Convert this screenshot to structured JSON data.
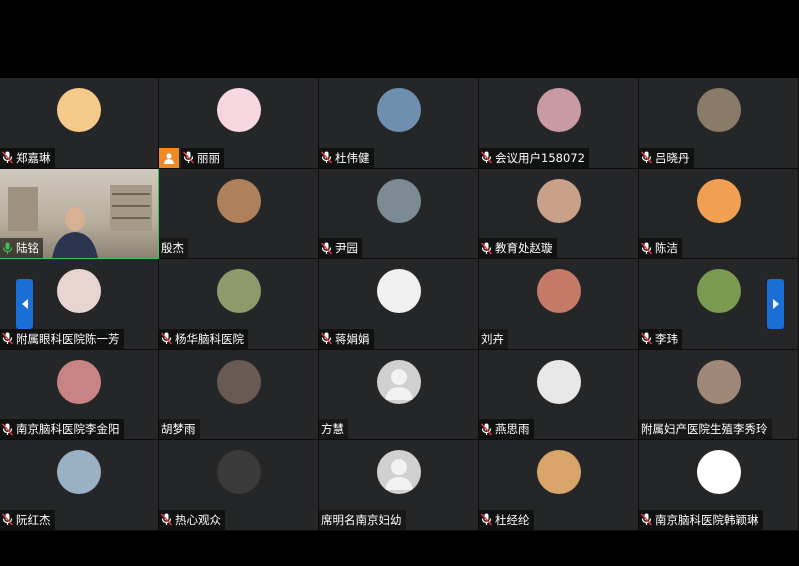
{
  "participants": [
    {
      "name": "郑嘉琳",
      "muted": true,
      "avatar": "cartoon-bear-avatar",
      "color": "#f4c98a"
    },
    {
      "name": "丽丽",
      "muted": true,
      "host": true,
      "avatar": "pink-calligraphy-avatar",
      "color": "#f6d6df"
    },
    {
      "name": "杜伟健",
      "muted": true,
      "avatar": "lake-landscape-avatar",
      "color": "#6f8fae"
    },
    {
      "name": "会议用户158072",
      "muted": true,
      "avatar": "bunny-avatar",
      "color": "#c89aa4"
    },
    {
      "name": "吕晓丹",
      "muted": true,
      "avatar": "room-photo-avatar",
      "color": "#8a7a68"
    },
    {
      "name": "陆铭",
      "muted": false,
      "video": true,
      "avatar": "live-video",
      "color": "#b7ae9d"
    },
    {
      "name": "殷杰",
      "muted": null,
      "avatar": "flower-photo-avatar",
      "color": "#b0805a"
    },
    {
      "name": "尹园",
      "muted": true,
      "avatar": "landscape-person-avatar",
      "color": "#7b8a93"
    },
    {
      "name": "教育处赵璇",
      "muted": true,
      "avatar": "woman-portrait-avatar",
      "color": "#c9a08a"
    },
    {
      "name": "陈洁",
      "muted": true,
      "avatar": "tiger-cartoon-avatar",
      "color": "#f0a050"
    },
    {
      "name": "附属眼科医院陈一芳",
      "muted": true,
      "avatar": "girl-portrait-avatar",
      "color": "#e8d5d2"
    },
    {
      "name": "杨华脑科医院",
      "muted": true,
      "avatar": "woman-glasses-avatar",
      "color": "#8f9a6c"
    },
    {
      "name": "蒋娟娟",
      "muted": true,
      "avatar": "man-suit-avatar",
      "color": "#f0f0f0"
    },
    {
      "name": "刘卉",
      "muted": null,
      "avatar": "pig-toy-avatar",
      "color": "#c47a66"
    },
    {
      "name": "李玮",
      "muted": true,
      "avatar": "sports-photo-avatar",
      "color": "#7a9a52"
    },
    {
      "name": "南京脑科医院李金阳",
      "muted": true,
      "avatar": "cartoon-sign-avatar",
      "color": "#c88484"
    },
    {
      "name": "胡梦雨",
      "muted": null,
      "avatar": "couple-photo-avatar",
      "color": "#6a5a54"
    },
    {
      "name": "方慧",
      "muted": null,
      "avatar": "default-user-avatar",
      "color": "#d0d0d0"
    },
    {
      "name": "燕思雨",
      "muted": true,
      "avatar": "black-white-figure-avatar",
      "color": "#e8e8e8"
    },
    {
      "name": "附属妇产医院生殖李秀玲",
      "muted": null,
      "avatar": "doctor-portrait-avatar",
      "color": "#a08878"
    },
    {
      "name": "阮红杰",
      "muted": true,
      "avatar": "beach-scene-avatar",
      "color": "#9ab0c4"
    },
    {
      "name": "热心观众",
      "muted": true,
      "avatar": "statue-avatar",
      "color": "#3a3a3a"
    },
    {
      "name": "席明名南京妇幼",
      "muted": null,
      "avatar": "default-user-avatar",
      "color": "#d0d0d0"
    },
    {
      "name": "杜经纶",
      "muted": true,
      "avatar": "child-photo-avatar",
      "color": "#d9a46a"
    },
    {
      "name": "南京脑科医院韩颖琳",
      "muted": true,
      "avatar": "smile-logo-avatar",
      "color": "#ffffff"
    }
  ],
  "nav": {
    "prev_icon": "chevron-left-icon",
    "next_icon": "chevron-right-icon",
    "accent": "#1a6fd6"
  },
  "host_badge_color": "#f08a24",
  "active_speaker_color": "#3fbf5a"
}
